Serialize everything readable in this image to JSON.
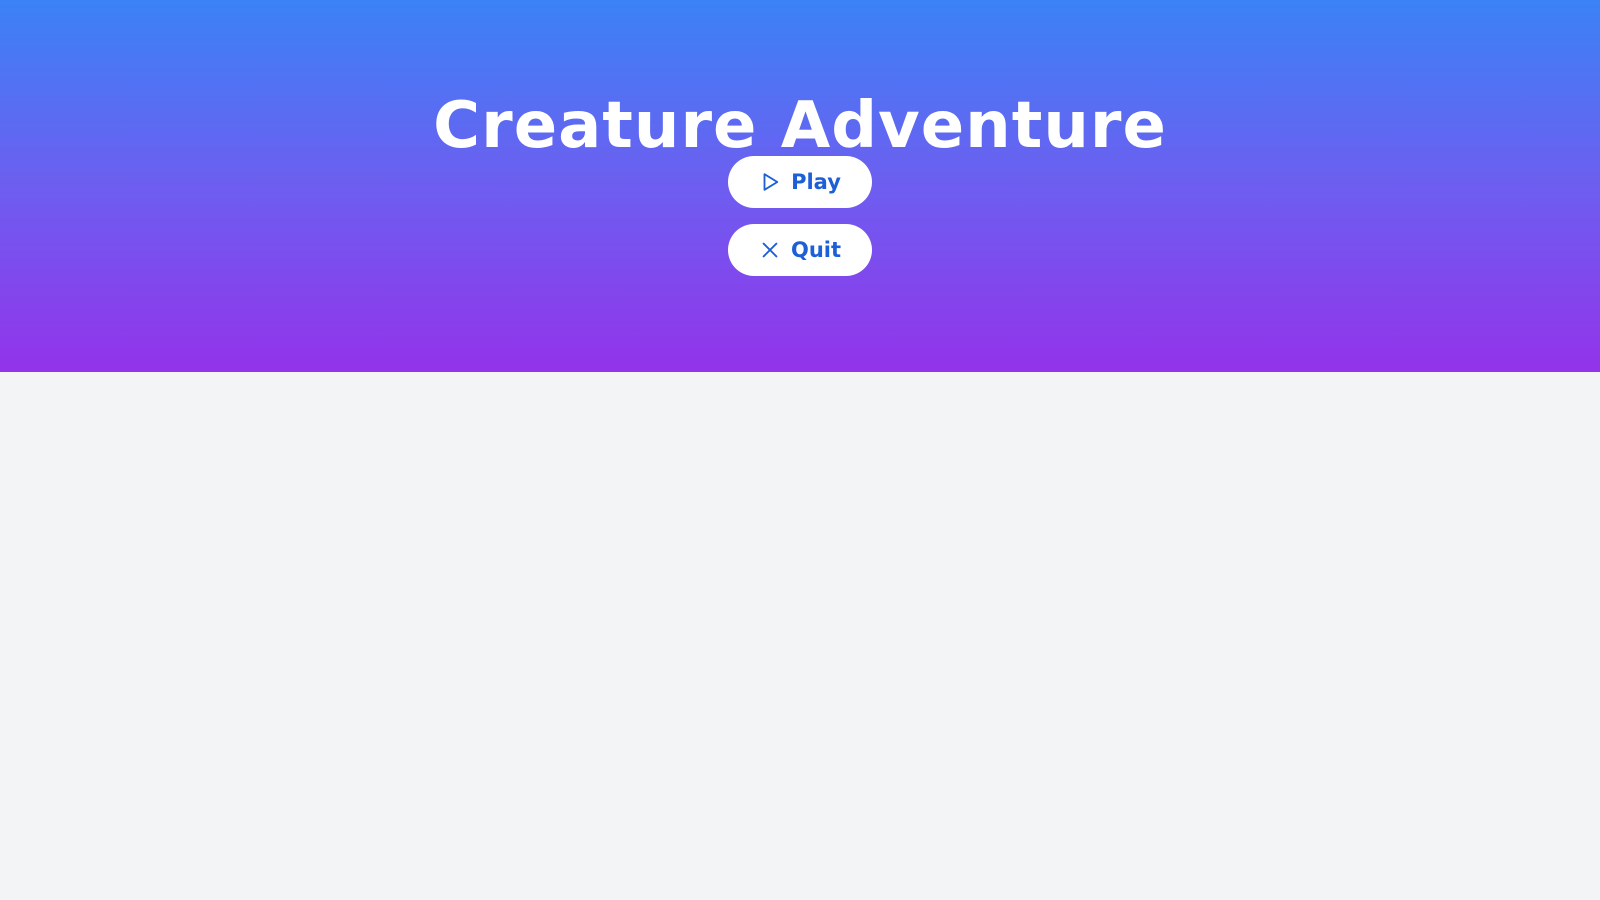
{
  "menu": {
    "title": "Creature Adventure",
    "buttons": [
      {
        "label": "Play",
        "icon": "play-icon"
      },
      {
        "label": "Quit",
        "icon": "close-icon"
      }
    ]
  },
  "colors": {
    "gradient_top": "#3b82f6",
    "gradient_bottom": "#9333ea",
    "button_text": "#1d5fd6",
    "button_background": "#ffffff",
    "page_background": "#f3f4f6"
  }
}
